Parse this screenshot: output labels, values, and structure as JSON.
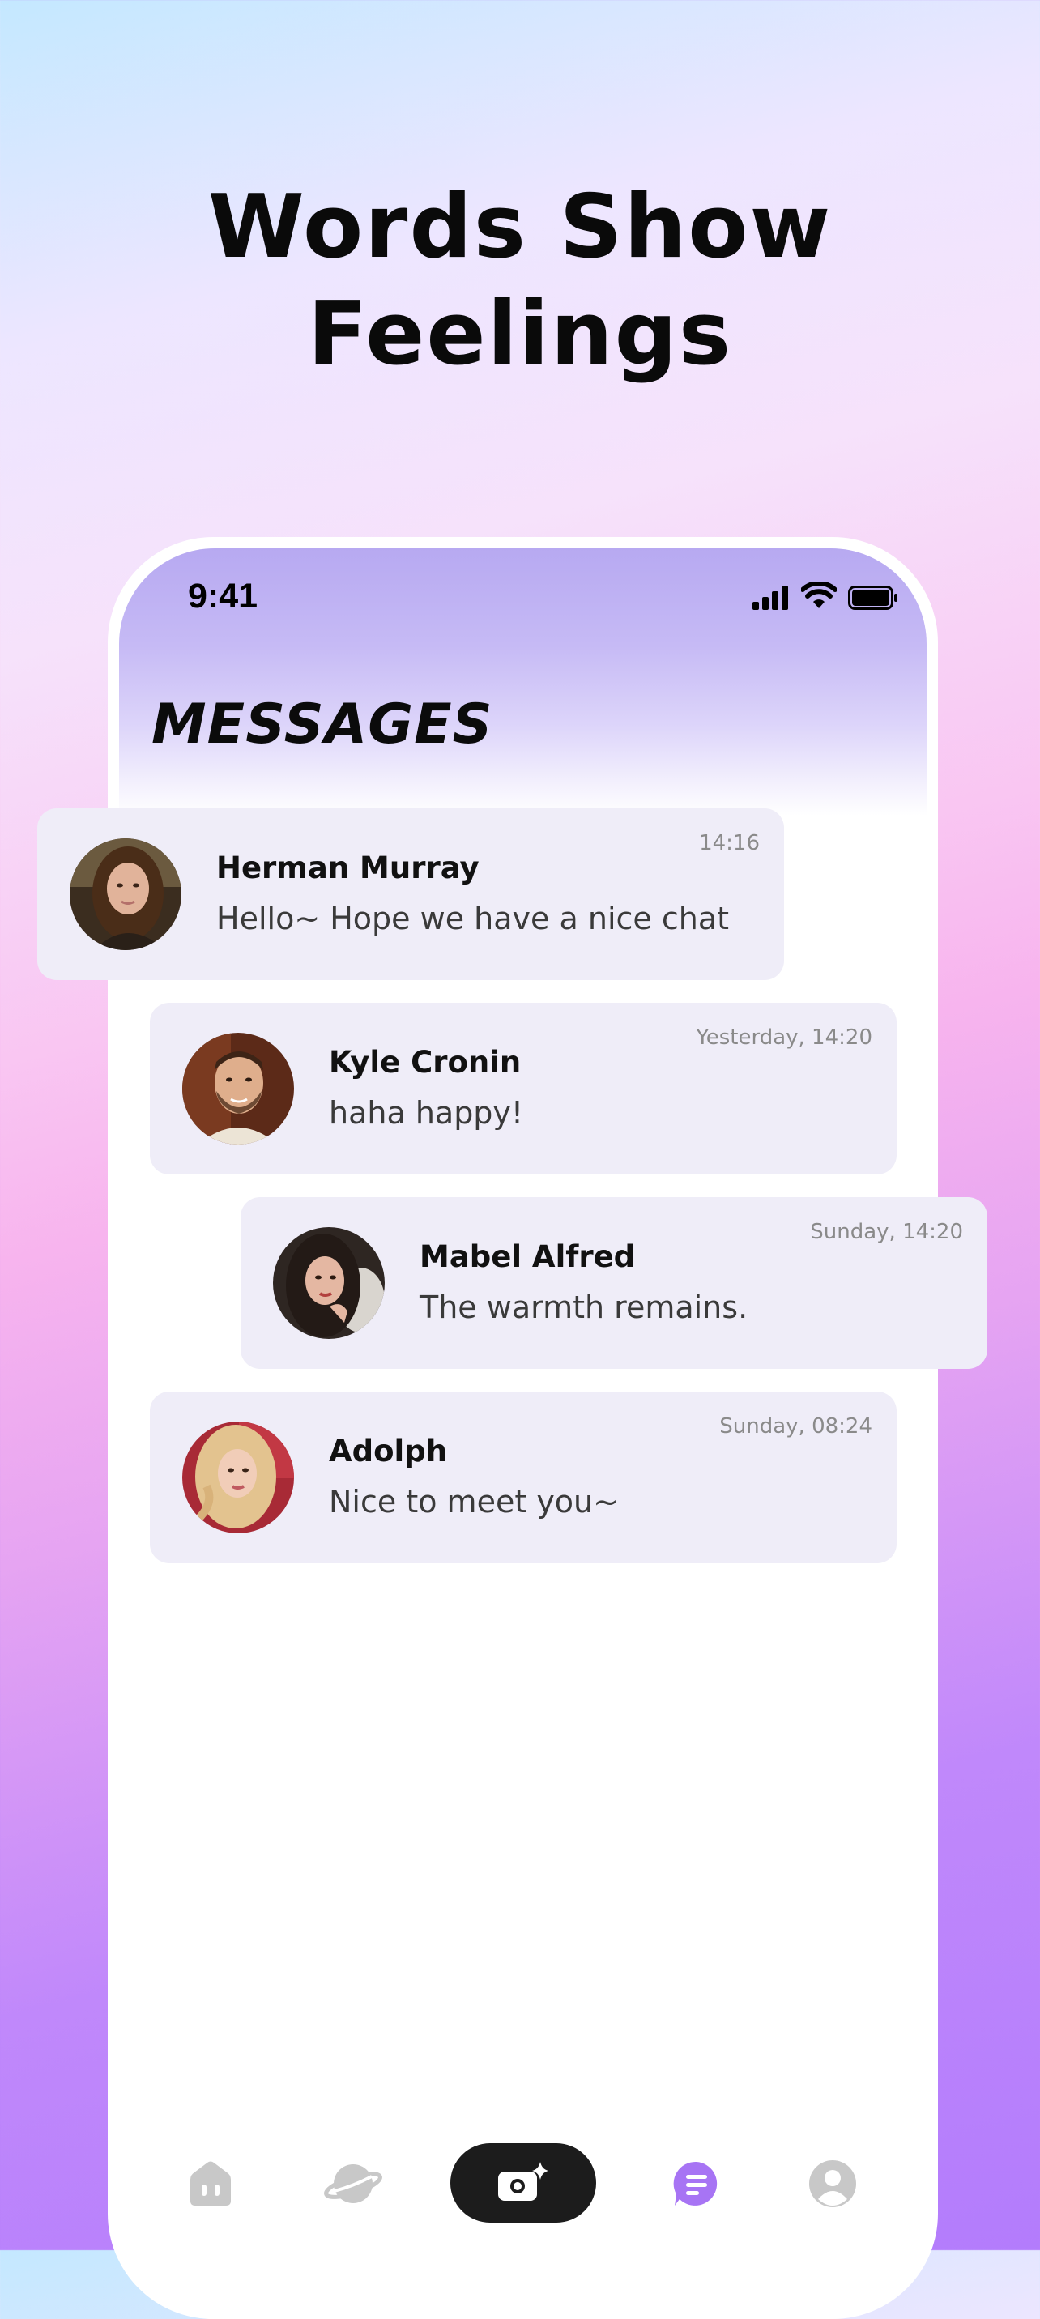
{
  "headline": {
    "line1": "Words Show",
    "line2": "Feelings"
  },
  "status_bar": {
    "time": "9:41",
    "icons": [
      "signal-icon",
      "wifi-icon",
      "battery-icon"
    ]
  },
  "screen": {
    "title": "MESSAGES"
  },
  "messages": [
    {
      "name": "Herman Murray",
      "text": "Hello~ Hope we have a nice chat",
      "time": "14:16",
      "avatar": "woman-dark-hair-avatar"
    },
    {
      "name": "Kyle Cronin",
      "text": "haha happy!",
      "time": "Yesterday, 14:20",
      "avatar": "man-beard-avatar"
    },
    {
      "name": "Mabel Alfred",
      "text": "The warmth remains.",
      "time": "Sunday, 14:20",
      "avatar": "woman-long-hair-avatar"
    },
    {
      "name": "Adolph",
      "text": "Nice to meet you~",
      "time": "Sunday, 08:24",
      "avatar": "woman-blonde-avatar"
    }
  ],
  "tab_bar": {
    "tabs": [
      "home-icon",
      "planet-icon",
      "camera-sparkle-icon",
      "chat-icon",
      "profile-icon"
    ],
    "active": "chat-icon"
  },
  "colors": {
    "accent": "#a774f4",
    "card": "#efedf8",
    "header_top": "#b7a9f1",
    "tab_inactive": "#c8c8c8",
    "camera_button": "#1c1c1c"
  }
}
